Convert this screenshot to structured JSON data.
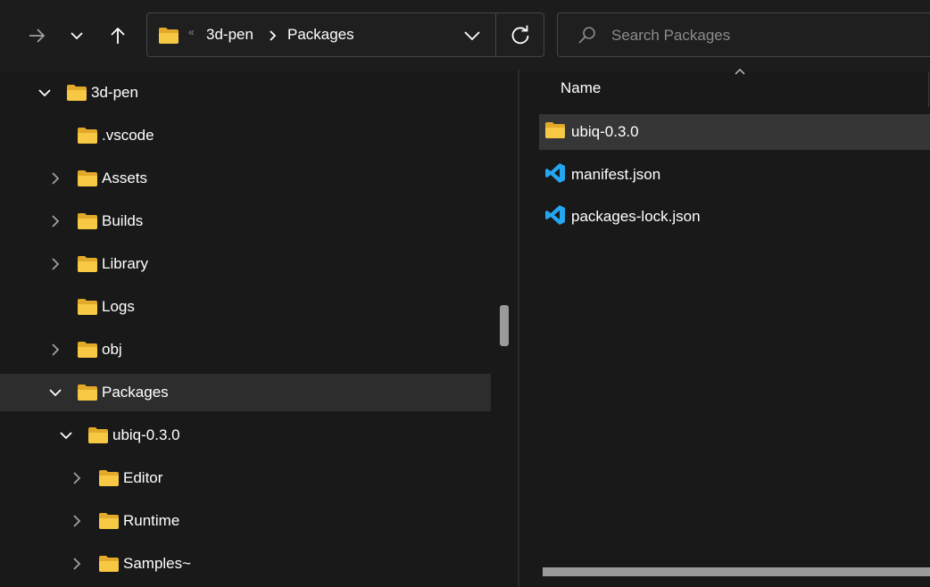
{
  "toolbar": {
    "forward_icon": "arrow-right-icon",
    "recent_icon": "chevron-down-icon",
    "up_icon": "arrow-up-icon"
  },
  "address": {
    "overflow": "«",
    "segments": [
      "3d-pen",
      "Packages"
    ],
    "separator": "›"
  },
  "search": {
    "placeholder": "Search Packages"
  },
  "tree": {
    "items": [
      {
        "label": "3d-pen",
        "expanded": true
      },
      {
        "label": ".vscode"
      },
      {
        "label": "Assets"
      },
      {
        "label": "Builds"
      },
      {
        "label": "Library"
      },
      {
        "label": "Logs"
      },
      {
        "label": "obj"
      },
      {
        "label": "Packages",
        "expanded": true,
        "selected": true
      },
      {
        "label": "ubiq-0.3.0",
        "expanded": true
      },
      {
        "label": "Editor"
      },
      {
        "label": "Runtime"
      },
      {
        "label": "Samples~"
      }
    ]
  },
  "content": {
    "column_name": "Name",
    "files": [
      {
        "label": "ubiq-0.3.0",
        "icon": "folder-icon",
        "selected": true
      },
      {
        "label": "manifest.json",
        "icon": "vscode-icon"
      },
      {
        "label": "packages-lock.json",
        "icon": "vscode-icon"
      }
    ]
  },
  "colors": {
    "background": "#191919",
    "folder": "#f7c843",
    "vscode": "#23a7f2",
    "selection": "#2d2d2d"
  }
}
